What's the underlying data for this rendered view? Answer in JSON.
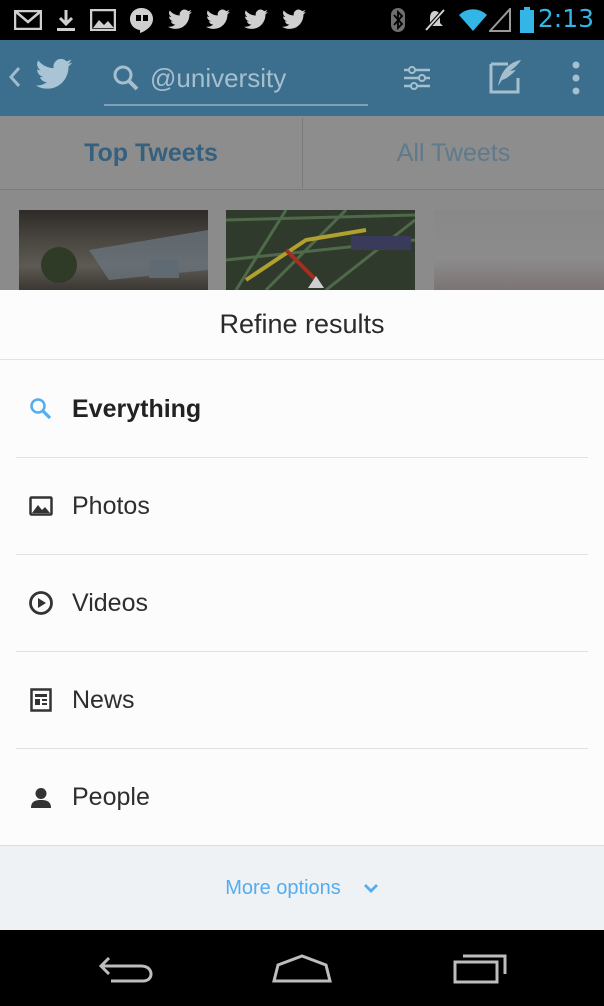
{
  "status_bar": {
    "time": "2:13",
    "icons": [
      "gmail-icon",
      "download-icon",
      "gallery-icon",
      "hangouts-icon",
      "twitter-icon",
      "twitter-icon",
      "twitter-icon",
      "twitter-icon",
      "bluetooth-icon",
      "mute-icon",
      "wifi-icon",
      "signal-icon",
      "battery-icon"
    ],
    "accent": "#33b5e5"
  },
  "app_bar": {
    "search_query": "@university",
    "icons": [
      "back-chevron-icon",
      "twitter-bird-icon",
      "search-icon",
      "filter-icon",
      "compose-icon",
      "overflow-menu-icon"
    ]
  },
  "tabs": [
    {
      "label": "Top Tweets",
      "selected": true
    },
    {
      "label": "All Tweets",
      "selected": false
    }
  ],
  "sheet": {
    "title": "Refine results",
    "options": [
      {
        "label": "Everything",
        "icon": "search-icon",
        "selected": true
      },
      {
        "label": "Photos",
        "icon": "photo-icon",
        "selected": false
      },
      {
        "label": "Videos",
        "icon": "video-play-icon",
        "selected": false
      },
      {
        "label": "News",
        "icon": "news-icon",
        "selected": false
      },
      {
        "label": "People",
        "icon": "person-icon",
        "selected": false
      }
    ],
    "more_options": "More options",
    "link_color": "#55acee"
  },
  "nav_bar": {
    "icons": [
      "back-nav-icon",
      "home-nav-icon",
      "recents-nav-icon"
    ]
  }
}
